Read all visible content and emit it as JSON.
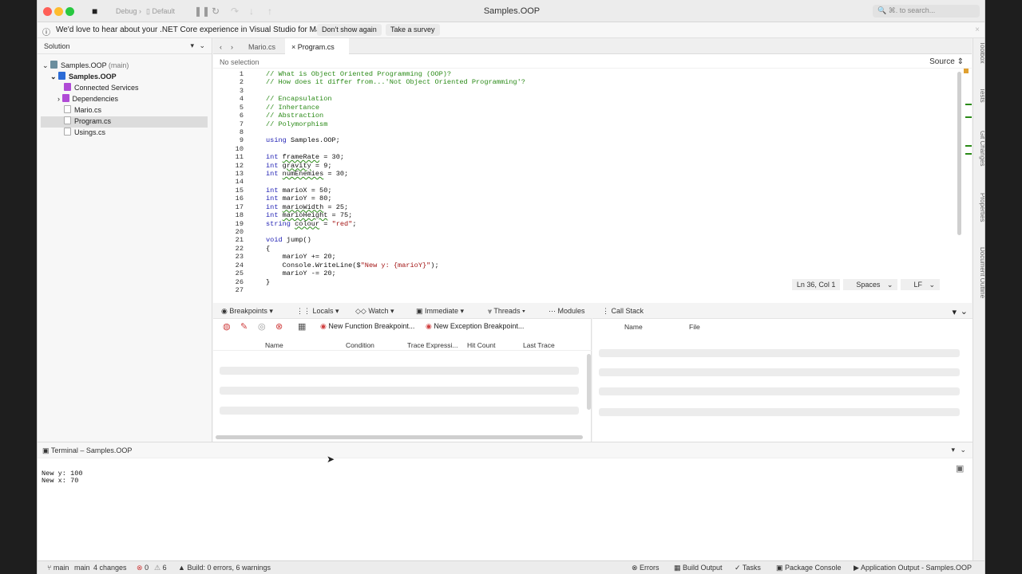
{
  "window": {
    "title": "Samples.OOP"
  },
  "toolbar": {
    "config": "Debug",
    "target": "Default",
    "search_placeholder": "⌘. to search..."
  },
  "infobar": {
    "message": "We'd love to hear about your .NET Core experience in Visual Studio for Mac.",
    "dont_show": "Don't show again",
    "survey": "Take a survey"
  },
  "solution": {
    "header": "Solution",
    "items": [
      {
        "label": "Samples.OOP",
        "suffix": "(main)"
      },
      {
        "label": "Samples.OOP"
      },
      {
        "label": "Connected Services"
      },
      {
        "label": "Dependencies"
      },
      {
        "label": "Mario.cs"
      },
      {
        "label": "Program.cs"
      },
      {
        "label": "Usings.cs"
      }
    ]
  },
  "editor": {
    "tabs": [
      {
        "label": "Mario.cs"
      },
      {
        "label": "Program.cs"
      }
    ],
    "breadcrumb": "No selection",
    "source_label": "Source",
    "lines": [
      {
        "n": "1",
        "t": "// What is Object Oriented Programming (OOP)?"
      },
      {
        "n": "2",
        "t": "// How does it differ from...'Not Object Oriented Programming'?"
      },
      {
        "n": "3",
        "t": ""
      },
      {
        "n": "4",
        "t": "// Encapsulation"
      },
      {
        "n": "5",
        "t": "// Inhertance"
      },
      {
        "n": "6",
        "t": "// Abstraction"
      },
      {
        "n": "7",
        "t": "// Polymorphism"
      },
      {
        "n": "8",
        "t": ""
      },
      {
        "n": "9",
        "t": "using Samples.OOP;"
      },
      {
        "n": "10",
        "t": ""
      },
      {
        "n": "11",
        "t": "int frameRate = 30;"
      },
      {
        "n": "12",
        "t": "int gravity = 9;"
      },
      {
        "n": "13",
        "t": "int numEnemies = 30;"
      },
      {
        "n": "14",
        "t": ""
      },
      {
        "n": "15",
        "t": "int marioX = 50;"
      },
      {
        "n": "16",
        "t": "int marioY = 80;"
      },
      {
        "n": "17",
        "t": "int marioWidth = 25;"
      },
      {
        "n": "18",
        "t": "int marioHeight = 75;"
      },
      {
        "n": "19",
        "t": "string colour = \"red\";"
      },
      {
        "n": "20",
        "t": ""
      },
      {
        "n": "21",
        "t": "void jump()"
      },
      {
        "n": "22",
        "t": "{"
      },
      {
        "n": "23",
        "t": "    marioY += 20;"
      },
      {
        "n": "24",
        "t": "    Console.WriteLine($\"New y: {marioY}\");"
      },
      {
        "n": "25",
        "t": "    marioY -= 20;"
      },
      {
        "n": "26",
        "t": "}"
      },
      {
        "n": "27",
        "t": ""
      }
    ],
    "status": {
      "position": "Ln 36, Col 1",
      "indent": "Spaces",
      "eol": "LF"
    }
  },
  "debug": {
    "tabs": [
      "Breakpoints",
      "Locals",
      "Watch",
      "Immediate",
      "Threads",
      "Modules"
    ],
    "new_function_bp": "New Function Breakpoint...",
    "new_exception_bp": "New Exception Breakpoint...",
    "columns": [
      "Name",
      "Condition",
      "Trace Expressi...",
      "Hit Count",
      "Last Trace"
    ]
  },
  "callstack": {
    "title": "Call Stack",
    "columns": [
      "Name",
      "File"
    ]
  },
  "terminal": {
    "title": "Terminal – Samples.OOP",
    "lines": [
      "New y: 100",
      "New x: 70"
    ]
  },
  "rail": [
    "Toolbox",
    "Tests",
    "Git Changes",
    "Properties",
    "Document Outline"
  ],
  "statusbar": {
    "branch": "main",
    "branch2": "main",
    "changes": "4 changes",
    "errors": "0",
    "warnings": "6",
    "build": "Build: 0 errors, 6 warnings",
    "pads": [
      "Errors",
      "Build Output",
      "Tasks",
      "Package Console",
      "Application Output - Samples.OOP"
    ]
  },
  "colors": {
    "comment": "#2a8a17",
    "keyword": "#1f1fb3",
    "string": "#a31515"
  }
}
